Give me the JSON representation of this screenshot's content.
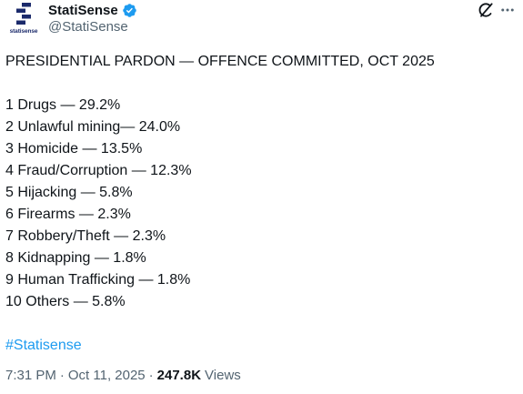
{
  "account": {
    "display_name": "StatiSense",
    "handle": "@StatiSense",
    "avatar_text": "statisense",
    "verified_color": "#1d9bf0",
    "brand_color": "#1b2a6b"
  },
  "icons": {
    "verified": "verified-badge-icon",
    "grok": "grok-icon",
    "more": "more-icon"
  },
  "post": {
    "title": "PRESIDENTIAL PARDON — OFFENCE COMMITTED, OCT 2025",
    "items": [
      "1 Drugs — 29.2%",
      "2 Unlawful mining— 24.0%",
      "3 Homicide — 13.5%",
      "4 Fraud/Corruption — 12.3%",
      "5 Hijacking — 5.8%",
      "6 Firearms — 2.3%",
      "7 Robbery/Theft — 2.3%",
      "8 Kidnapping — 1.8%",
      "9 Human Trafficking — 1.8%",
      "10 Others — 5.8%"
    ],
    "hashtag": "#Statisense",
    "hashtag_color": "#1d9bf0"
  },
  "meta": {
    "time": "7:31 PM",
    "separator": "·",
    "date": "Oct 11, 2025",
    "views_count": "247.8K",
    "views_label": "Views"
  }
}
